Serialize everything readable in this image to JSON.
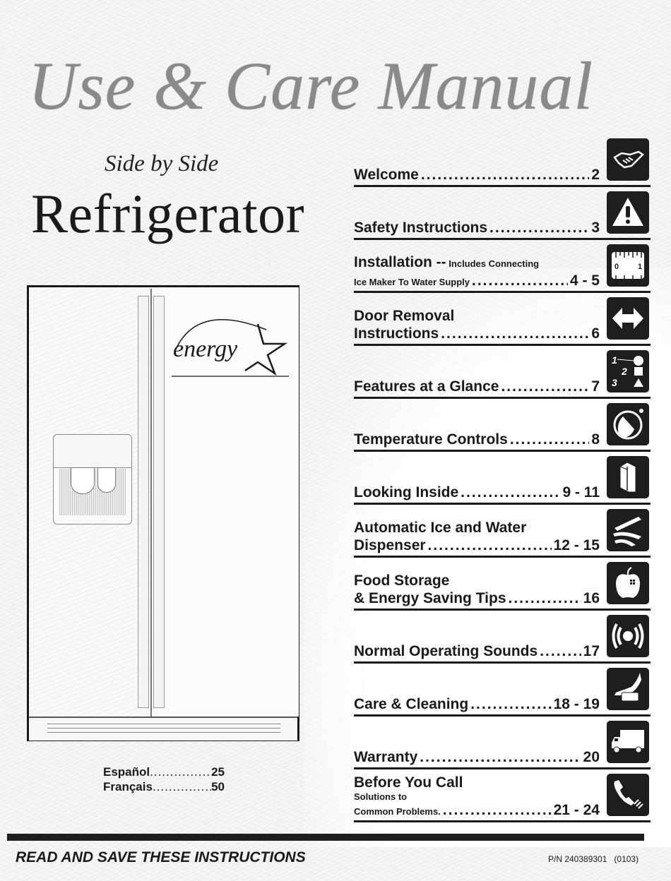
{
  "cover": {
    "title": "Use & Care Manual",
    "subtitle": "Side by Side",
    "product": "Refrigerator",
    "energy_logo_text": "energy"
  },
  "languages": [
    {
      "label": "Español",
      "dots": "...............................",
      "page": "25"
    },
    {
      "label": "Français",
      "dots": "...............................",
      "page": "50"
    }
  ],
  "toc": [
    {
      "lines": [
        {
          "text": "Welcome",
          "page": "2"
        }
      ],
      "icon": "handshake-icon"
    },
    {
      "lines": [
        {
          "text": "Safety Instructions",
          "page": "3"
        }
      ],
      "icon": "warning-icon"
    },
    {
      "head": "Installation --",
      "head_small": " Includes Connecting",
      "small_line": {
        "text": "Ice Maker To Water Supply",
        "page": "4 - 5"
      },
      "icon": "ruler-icon"
    },
    {
      "head": "Door Removal",
      "lines": [
        {
          "text": "Instructions",
          "page": "6"
        }
      ],
      "icon": "double-arrow-icon"
    },
    {
      "lines": [
        {
          "text": "Features at a Glance",
          "page": "7"
        }
      ],
      "icon": "numbered-shapes-icon"
    },
    {
      "lines": [
        {
          "text": "Temperature Controls",
          "page": "8"
        }
      ],
      "icon": "dial-hand-icon"
    },
    {
      "lines": [
        {
          "text": "Looking Inside",
          "page": "9 - 11"
        }
      ],
      "icon": "fridge-box-icon"
    },
    {
      "head": "Automatic Ice and Water",
      "lines": [
        {
          "text": "Dispenser",
          "page": "12 - 15"
        }
      ],
      "icon": "ice-cubes-icon"
    },
    {
      "head": "Food Storage",
      "lines": [
        {
          "text": "& Energy Saving Tips",
          "page": "16"
        }
      ],
      "icon": "apple-icon"
    },
    {
      "lines": [
        {
          "text": "Normal Operating Sounds",
          "page": "17"
        }
      ],
      "icon": "sound-waves-icon"
    },
    {
      "lines": [
        {
          "text": "Care & Cleaning",
          "page": "18 - 19"
        }
      ],
      "icon": "hand-sponge-icon"
    },
    {
      "lines": [
        {
          "text": "Warranty",
          "page": "20"
        }
      ],
      "icon": "service-truck-icon"
    },
    {
      "head": "Before You Call",
      "small_plain": "Solutions to",
      "small_line": {
        "text": "Common Problems.",
        "page": "21 - 24"
      },
      "icon": "telephone-icon"
    }
  ],
  "dots": "..............................................................",
  "footer": {
    "left": "READ AND SAVE THESE INSTRUCTIONS",
    "part_number": "P/N 240389301   (0103)"
  }
}
